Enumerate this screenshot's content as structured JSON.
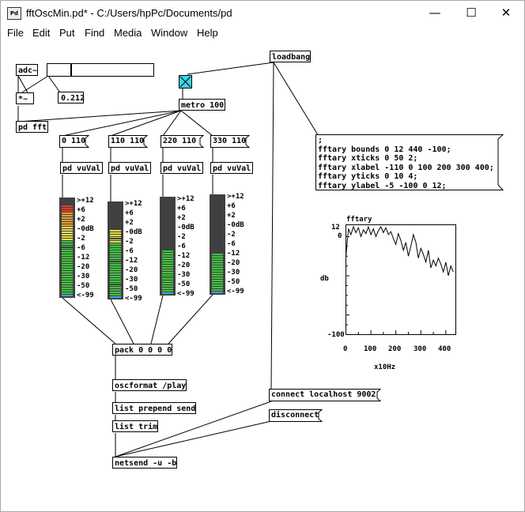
{
  "window": {
    "app_icon": "Pd",
    "title": "fftOscMin.pd* - C:/Users/hpPc/Documents/pd",
    "minimize": "—",
    "maximize": "☐",
    "close": "✕"
  },
  "menu": [
    "File",
    "Edit",
    "Put",
    "Find",
    "Media",
    "Window",
    "Help"
  ],
  "objects": {
    "adc": "adc~",
    "mul": "*~",
    "pdfft": "pd fft",
    "loadbang": "loadbang",
    "metro": "metro 100",
    "pack": "pack 0 0 0 0",
    "oscformat": "oscformat /play",
    "listprepend": "list prepend send",
    "listtrim": "list trim",
    "netsend": "netsend -u -b",
    "vuvals": [
      "pd vuVal",
      "pd vuVal",
      "pd vuVal",
      "pd vuVal"
    ]
  },
  "number_box": {
    "value": "0.212"
  },
  "messages": {
    "bands": [
      "0 110",
      "110 110",
      "220 110",
      "330 110"
    ],
    "connect": "connect localhost 9002",
    "disconnect": "disconnect",
    "fftary_config": ";\nfftary bounds 0 12 440 -100;\nfftary xticks 0 50 2;\nfftary xlabel -110 0 100 200 300 400;\nfftary yticks 0 10 4;\nfftary ylabel -5 -100 0 12;"
  },
  "vu_scale": [
    ">+12",
    "+6",
    "+2",
    "-0dB",
    "-2",
    "-6",
    "-12",
    "-20",
    "-30",
    "-50",
    "<-99"
  ],
  "vu_levels": [
    0.95,
    0.72,
    0.45,
    0.41
  ],
  "graph": {
    "name": "fftary",
    "ylabel_axis": "db",
    "xlabel_axis": "x10Hz",
    "y_ticks": [
      "12",
      "0",
      "-100"
    ],
    "x_ticks": [
      "0",
      "100",
      "200",
      "300",
      "400"
    ]
  },
  "chart_data": {
    "type": "line",
    "title": "fftary",
    "xlabel": "x10Hz",
    "ylabel": "db",
    "xlim": [
      0,
      440
    ],
    "ylim": [
      -100,
      12
    ],
    "x": [
      0,
      10,
      20,
      30,
      40,
      50,
      60,
      70,
      80,
      90,
      100,
      110,
      120,
      130,
      140,
      150,
      160,
      170,
      180,
      190,
      200,
      210,
      220,
      230,
      240,
      250,
      260,
      270,
      280,
      290,
      300,
      310,
      320,
      330,
      340,
      350,
      360,
      370,
      380,
      390,
      400,
      410,
      420,
      430
    ],
    "y": [
      -20,
      8,
      2,
      10,
      4,
      9,
      0,
      7,
      3,
      10,
      2,
      8,
      0,
      6,
      10,
      4,
      9,
      2,
      5,
      -2,
      -8,
      3,
      -4,
      -14,
      -6,
      -20,
      -10,
      2,
      -6,
      -22,
      -12,
      -18,
      -26,
      -14,
      -32,
      -24,
      -30,
      -22,
      -28,
      -36,
      -26,
      -40,
      -30,
      -36
    ],
    "grid": false
  }
}
